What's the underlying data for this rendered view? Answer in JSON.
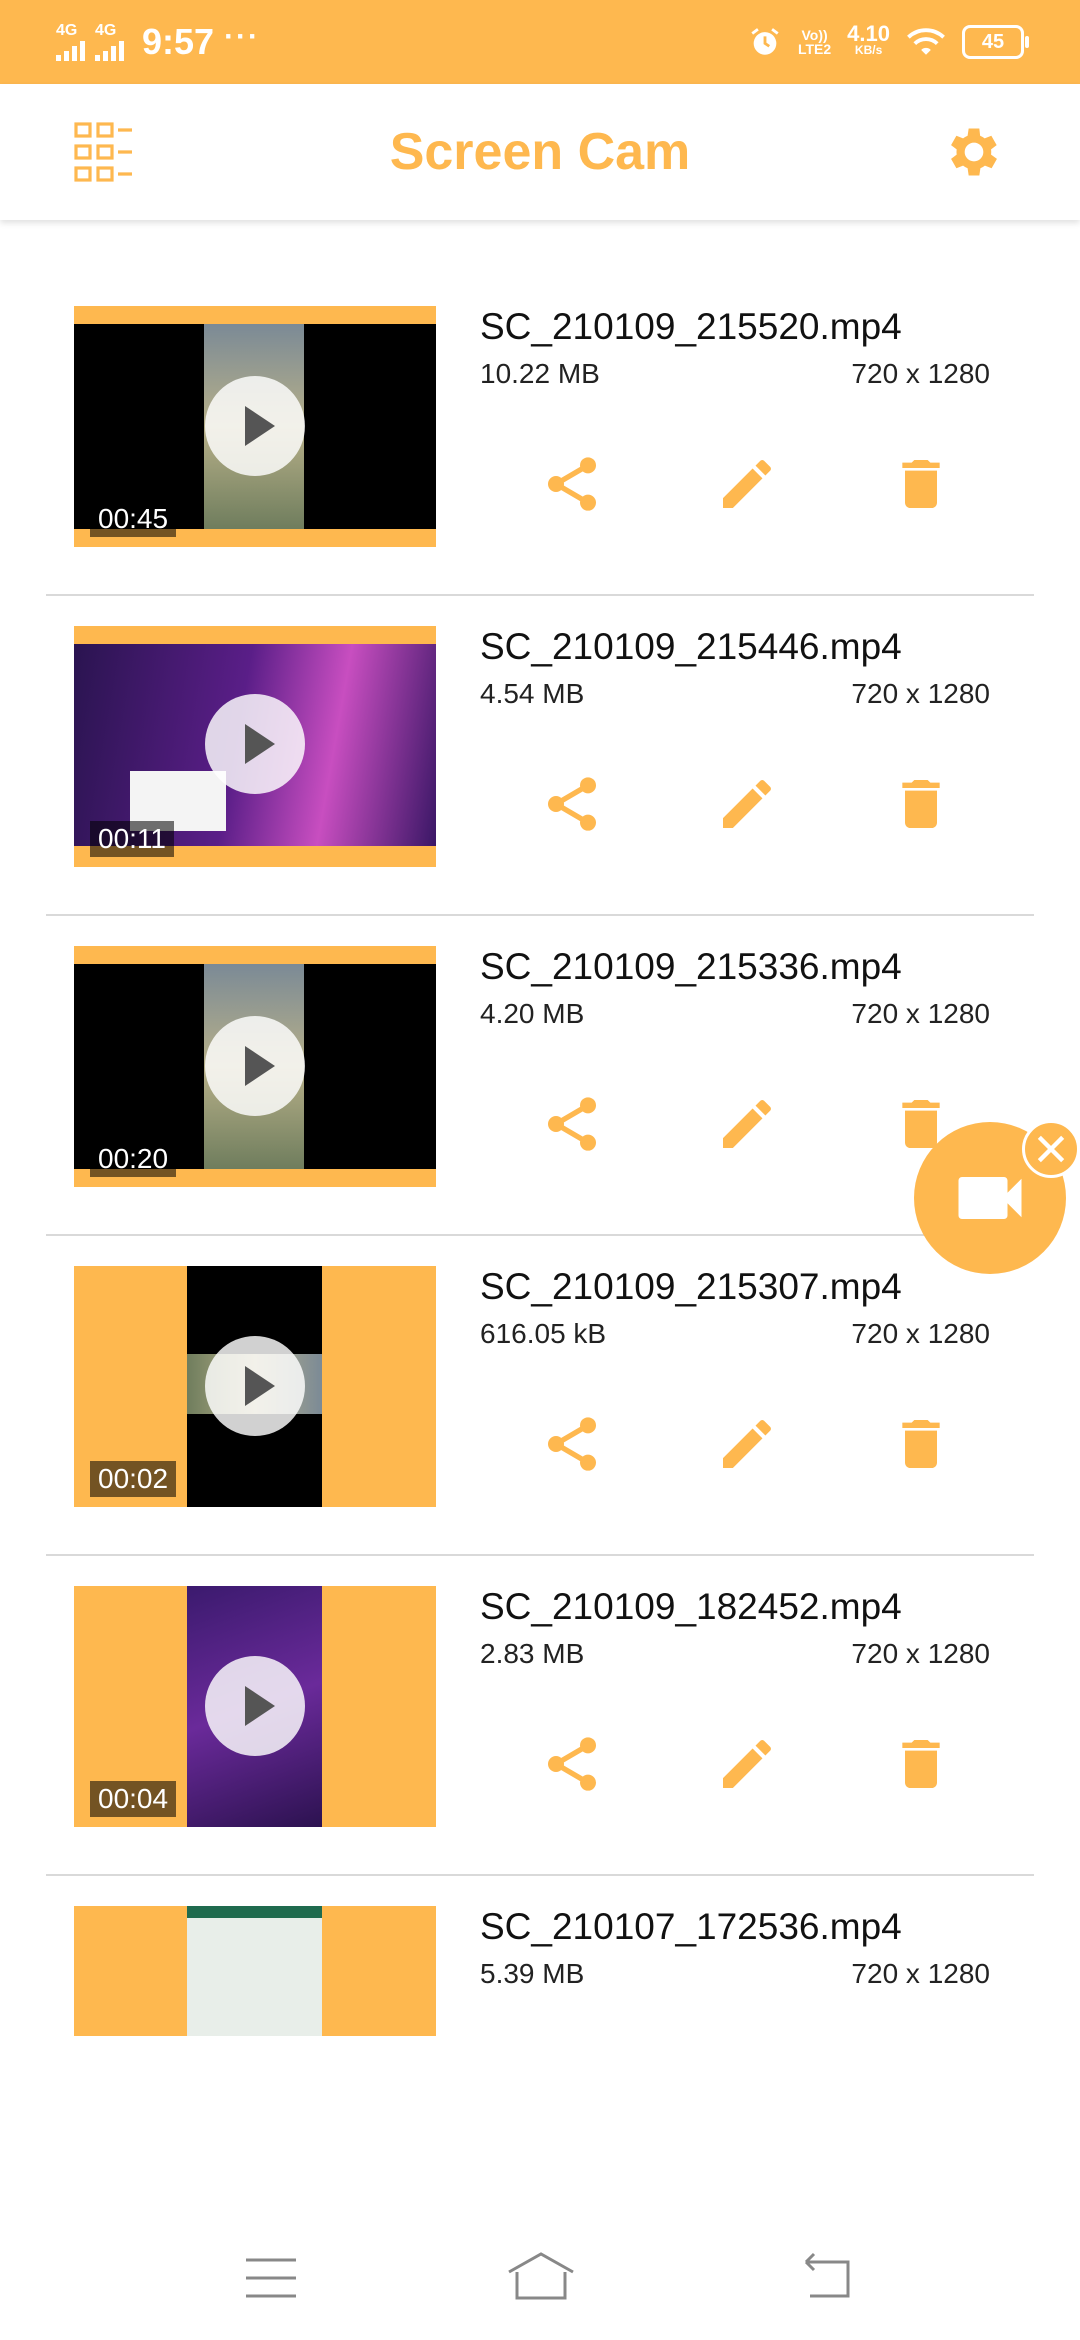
{
  "status_bar": {
    "network1": "4G",
    "network2": "4G",
    "time": "9:57",
    "more": "···",
    "volte_top": "Vo))",
    "volte_bottom": "LTE2",
    "speed_value": "4.10",
    "speed_unit": "KB/s",
    "battery": "45"
  },
  "app_bar": {
    "title": "Screen Cam",
    "left_icon": "gallery-grid-icon",
    "right_icon": "gear-icon"
  },
  "videos": [
    {
      "filename": "SC_210109_215520.mp4",
      "size": "10.22 MB",
      "resolution": "720 x 1280",
      "duration": "00:45"
    },
    {
      "filename": "SC_210109_215446.mp4",
      "size": "4.54 MB",
      "resolution": "720 x 1280",
      "duration": "00:11"
    },
    {
      "filename": "SC_210109_215336.mp4",
      "size": "4.20 MB",
      "resolution": "720 x 1280",
      "duration": "00:20"
    },
    {
      "filename": "SC_210109_215307.mp4",
      "size": "616.05 kB",
      "resolution": "720 x 1280",
      "duration": "00:02"
    },
    {
      "filename": "SC_210109_182452.mp4",
      "size": "2.83 MB",
      "resolution": "720 x 1280",
      "duration": "00:04"
    },
    {
      "filename": "SC_210107_172536.mp4",
      "size": "5.39 MB",
      "resolution": "720 x 1280",
      "duration": ""
    }
  ],
  "actions": [
    "share-icon",
    "edit-pencil-icon",
    "delete-trash-icon"
  ],
  "floating_button": {
    "icon": "video-camera-icon",
    "close_icon": "close-icon"
  },
  "nav_bar": [
    "menu-icon",
    "home-icon",
    "back-icon"
  ],
  "colors": {
    "accent": "#FEB84F",
    "background": "#FFFFFF",
    "divider": "#D9D9D9"
  }
}
